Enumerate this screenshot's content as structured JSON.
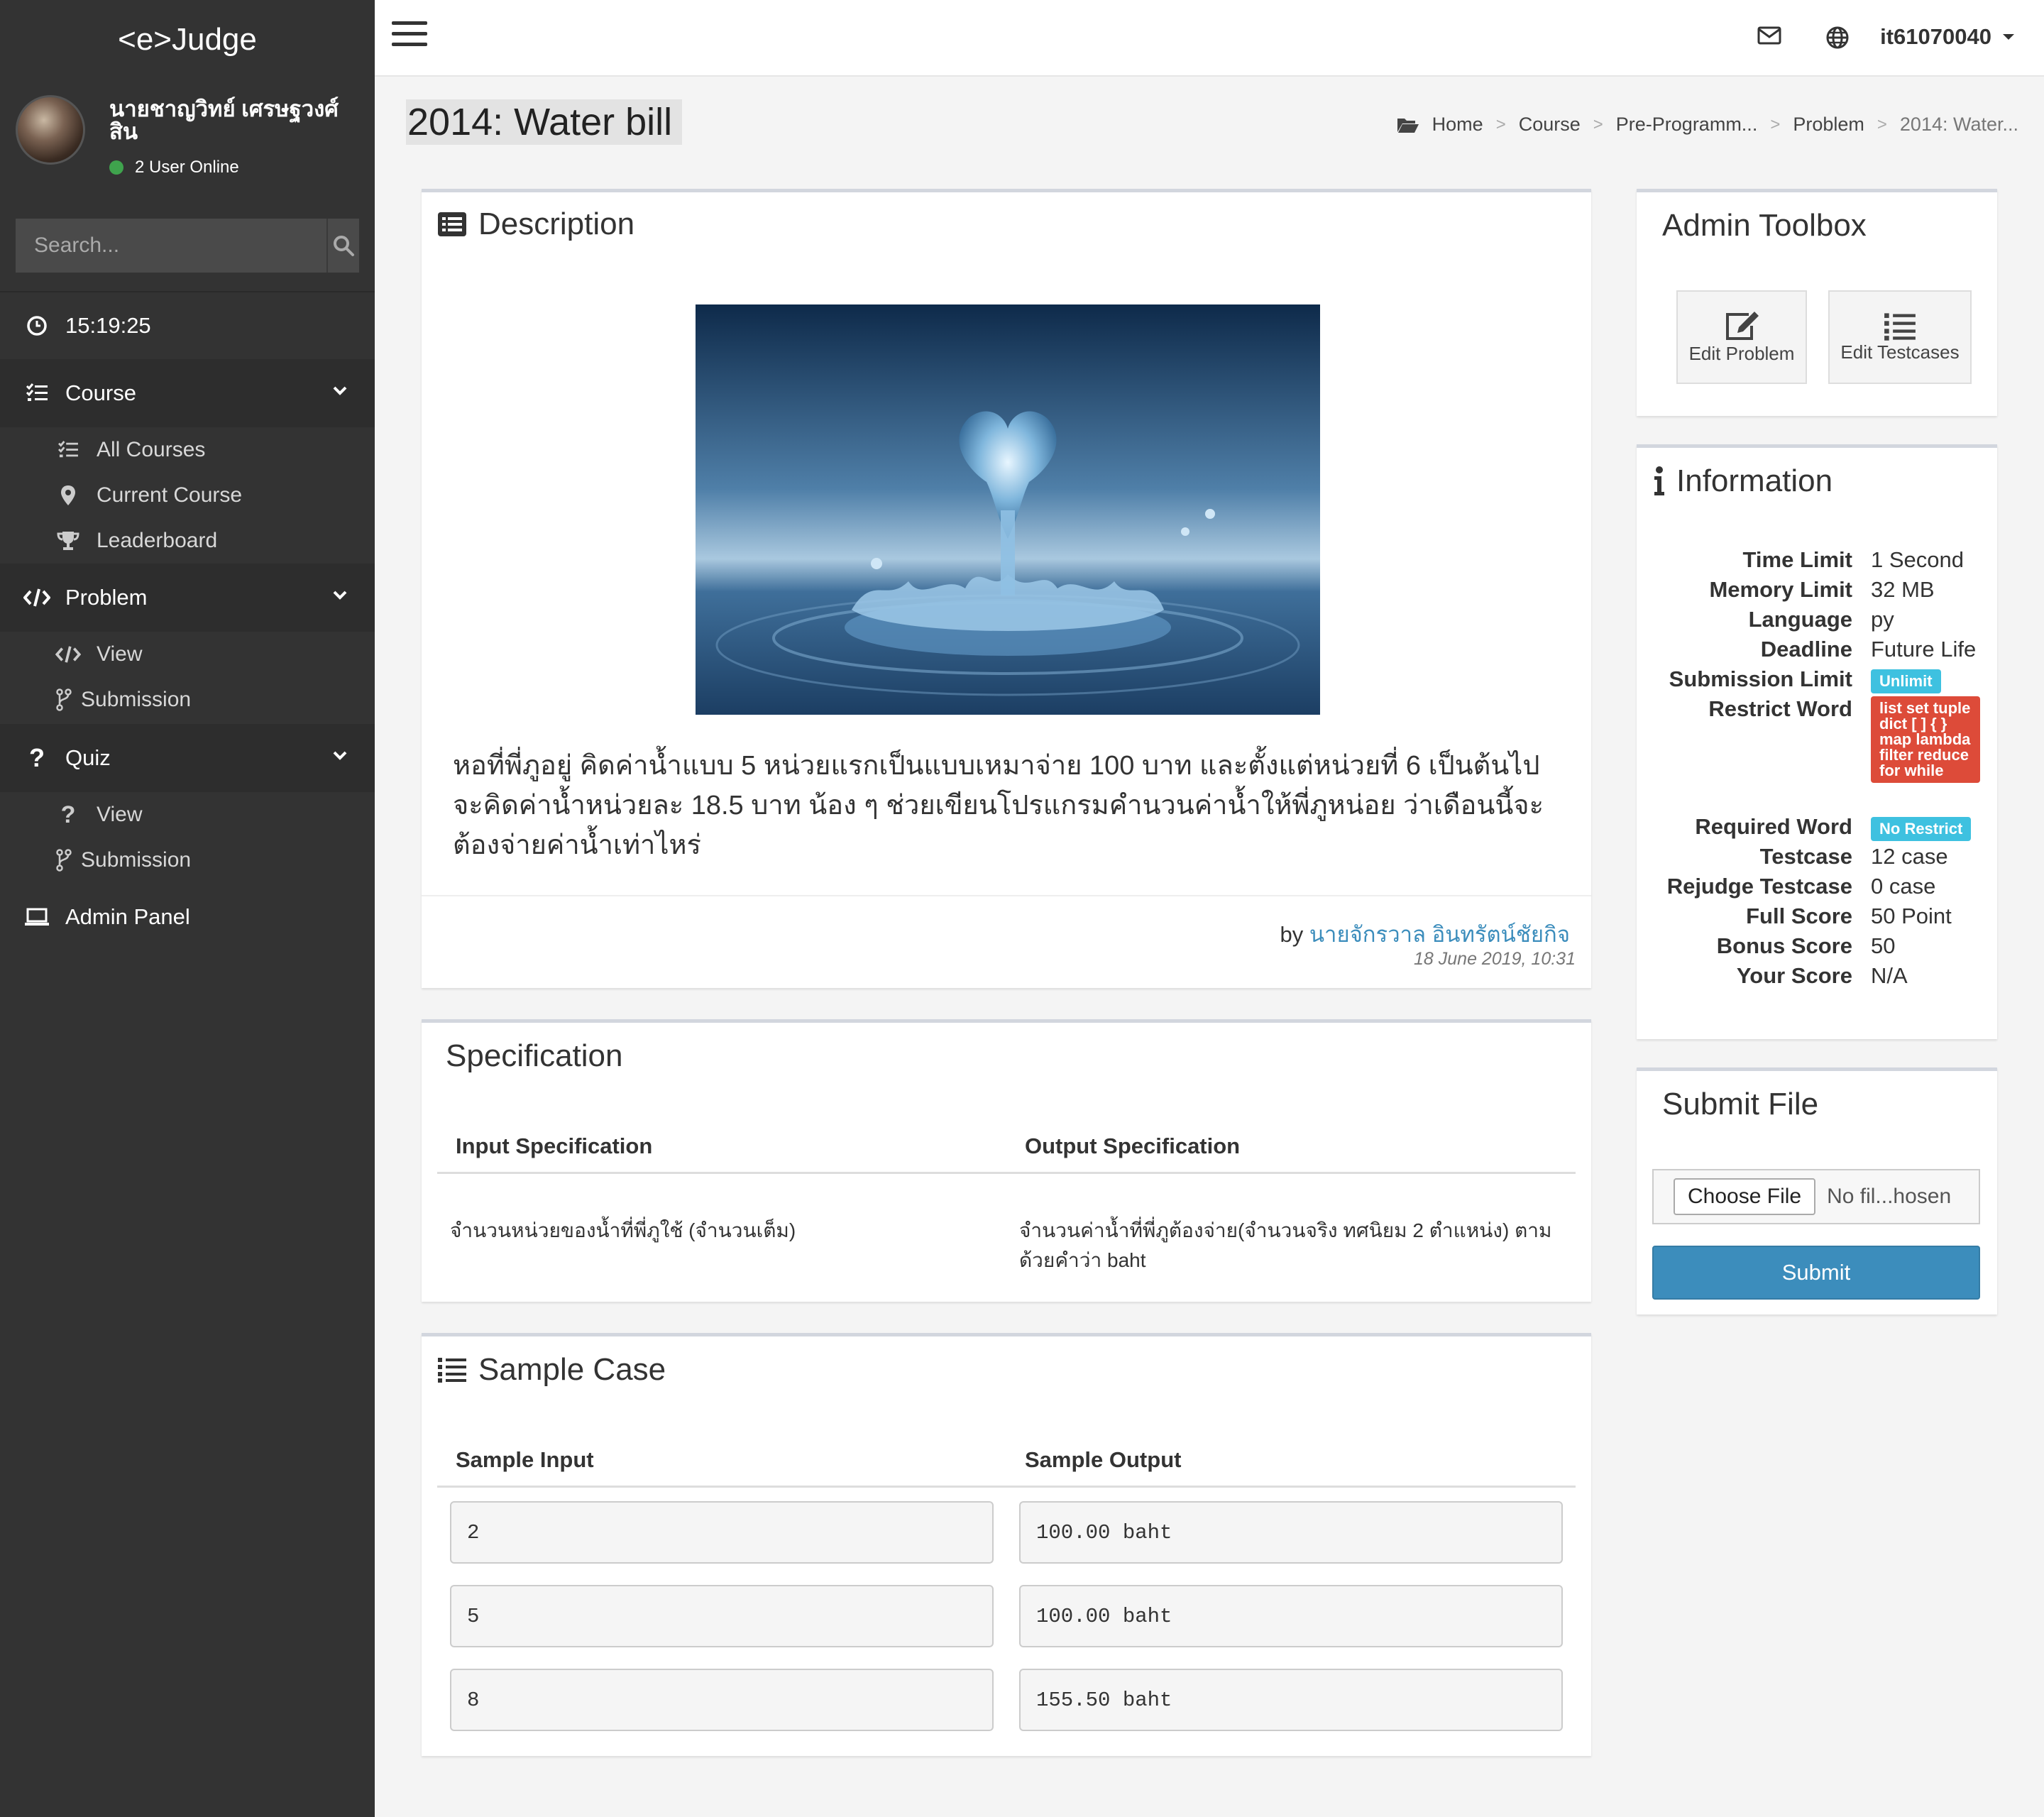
{
  "app": {
    "logo": "<e>Judge"
  },
  "user": {
    "name": "นายชาญวิทย์ เศรษฐวงศ์สิน",
    "online": "2 User Online",
    "account": "it61070040"
  },
  "search": {
    "placeholder": "Search..."
  },
  "clock": "15:19:25",
  "sidebar": {
    "course": {
      "label": "Course",
      "items": [
        "All Courses",
        "Current Course",
        "Leaderboard"
      ]
    },
    "problem": {
      "label": "Problem",
      "items": [
        "View",
        "Submission"
      ]
    },
    "quiz": {
      "label": "Quiz",
      "items": [
        "View",
        "Submission"
      ]
    },
    "admin": "Admin Panel"
  },
  "page": {
    "title": "2014: Water bill"
  },
  "breadcrumb": [
    "Home",
    "Course",
    "Pre-Programm...",
    "Problem",
    "2014: Water..."
  ],
  "description": {
    "title": "Description",
    "text": "หอที่พี่ภูอยู่ คิดค่าน้ำแบบ 5 หน่วยแรกเป็นแบบเหมาจ่าย 100 บาท และตั้งแต่หน่วยที่ 6 เป็นต้นไป จะคิดค่าน้ำหน่วยละ 18.5 บาท น้อง ๆ ช่วยเขียนโปรแกรมคำนวนค่าน้ำให้พี่ภูหน่อย ว่าเดือนนี้จะต้องจ่ายค่าน้ำเท่าไหร่",
    "by_prefix": "by",
    "author": "นายจักรวาล อินทรัตน์ชัยกิจ",
    "date": "18 June 2019, 10:31"
  },
  "specification": {
    "title": "Specification",
    "input_header": "Input Specification",
    "output_header": "Output Specification",
    "input": "จำนวนหน่วยของน้ำที่พี่ภูใช้ (จำนวนเต็ม)",
    "output": "จำนวนค่าน้ำที่พี่ภูต้องจ่าย(จำนวนจริง ทศนิยม 2 ตำแหน่ง) ตามด้วยคำว่า baht"
  },
  "sample_case": {
    "title": "Sample Case",
    "input_header": "Sample Input",
    "output_header": "Sample Output",
    "rows": [
      {
        "input": "2",
        "output": "100.00 baht"
      },
      {
        "input": "5",
        "output": "100.00 baht"
      },
      {
        "input": "8",
        "output": "155.50 baht"
      }
    ]
  },
  "admin_toolbox": {
    "title": "Admin Toolbox",
    "edit_problem": "Edit Problem",
    "edit_testcases": "Edit Testcases"
  },
  "information": {
    "title": "Information",
    "rows": [
      {
        "label": "Time Limit",
        "value": "1 Second"
      },
      {
        "label": "Memory Limit",
        "value": "32 MB"
      },
      {
        "label": "Language",
        "value": "py"
      },
      {
        "label": "Deadline",
        "value": "Future Life"
      },
      {
        "label": "Submission Limit",
        "value": "Unlimit"
      },
      {
        "label": "Restrict Word",
        "value": "list set tuple dict [ ] { } map lambda filter reduce for while"
      },
      {
        "label": "Required Word",
        "value": "No Restrict"
      },
      {
        "label": "Testcase",
        "value": "12 case"
      },
      {
        "label": "Rejudge Testcase",
        "value": "0 case"
      },
      {
        "label": "Full Score",
        "value": "50 Point"
      },
      {
        "label": "Bonus Score",
        "value": "50"
      },
      {
        "label": "Your Score",
        "value": "N/A"
      }
    ]
  },
  "submit_file": {
    "title": "Submit File",
    "choose_label": "Choose File",
    "file_status": "No fil...hosen",
    "submit_label": "Submit"
  },
  "colors": {
    "sidebar": "#333333",
    "primary": "#3c8dbc",
    "info_badge": "#3ec1e0",
    "danger_badge": "#dd4b39",
    "online": "#3fa34d"
  },
  "icons": [
    "menu-icon",
    "envelope-icon",
    "globe-icon",
    "caret-down-icon",
    "search-icon",
    "clock-icon",
    "tasks-icon",
    "map-marker-icon",
    "trophy-icon",
    "code-icon",
    "code-fork-icon",
    "question-icon",
    "laptop-icon",
    "folder-open-icon",
    "list-alt-icon",
    "list-ol-icon",
    "info-icon",
    "edit-icon"
  ]
}
